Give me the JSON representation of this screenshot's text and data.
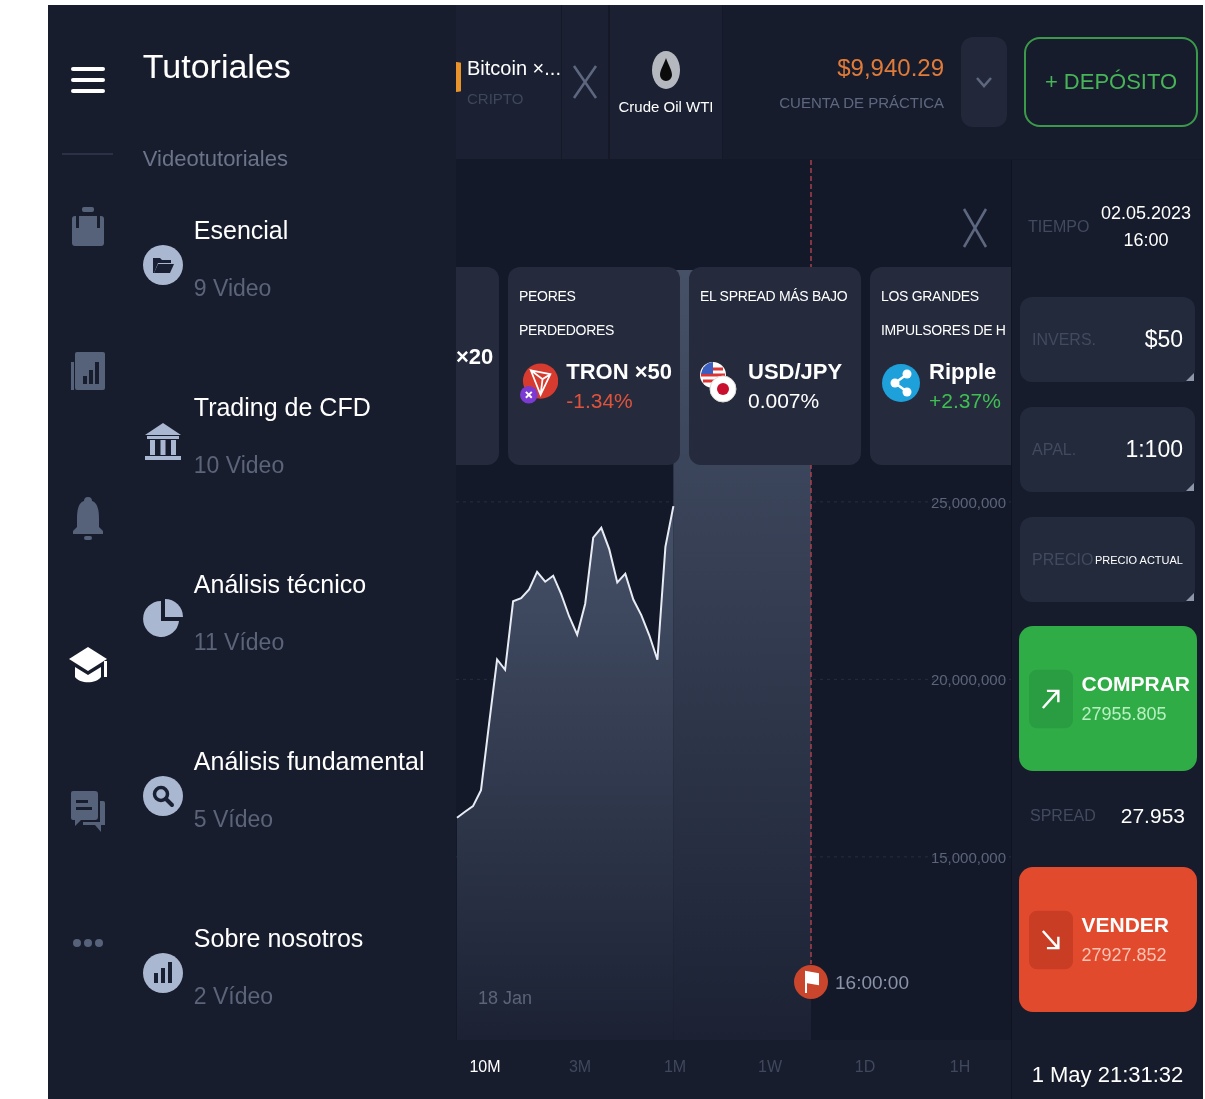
{
  "rail": [
    {
      "kind": "briefcase",
      "selected": false
    },
    {
      "kind": "chart",
      "selected": false
    },
    {
      "kind": "bell",
      "selected": false
    },
    {
      "kind": "cap",
      "selected": true
    },
    {
      "kind": "chat",
      "selected": false
    },
    {
      "kind": "more",
      "selected": false
    }
  ],
  "tutorials": {
    "title": "Tutoriales",
    "section": "Videotutoriales",
    "items": [
      {
        "kind": "folder",
        "title": "Esencial",
        "count": "9 Video"
      },
      {
        "kind": "bank",
        "title": "Trading de CFD",
        "count": "10 Video"
      },
      {
        "kind": "pie",
        "title": "Análisis técnico",
        "count": "11 Vídeo"
      },
      {
        "kind": "search",
        "title": "Análisis fundamental",
        "count": "5 Vídeo"
      },
      {
        "kind": "bars",
        "title": "Sobre nosotros",
        "count": "2 Vídeo"
      }
    ]
  },
  "tabs": [
    {
      "kind": "crypto",
      "title": "Bitcoin ×...",
      "subtitle": "CRIPTO"
    },
    {
      "kind": "oil",
      "title": "Crude Oil WTI"
    }
  ],
  "balance": {
    "amount": "$9,940.29",
    "account": "CUENTA DE PRÁCTICA"
  },
  "deposit_button": "+ DEPÓSITO",
  "cards": [
    {
      "kind": "stub",
      "name": "×20"
    },
    {
      "kind": "tron",
      "title": "PEORES PERDEDORES",
      "name": "TRON ×50",
      "change": "-1.34%",
      "color": "#e0533a"
    },
    {
      "kind": "flags",
      "title": "EL SPREAD MÁS BAJO",
      "name": "USD/JPY",
      "change": "0.007%",
      "color": "#ffffff"
    },
    {
      "kind": "ripple",
      "title": "LOS GRANDES IMPULSORES DE H",
      "name": "Ripple",
      "change": "+2.37%",
      "color": "#3fbf52"
    }
  ],
  "chart": {
    "chart_data": {
      "type": "area",
      "grid": true,
      "ylim": [
        8263604,
        34630000
      ],
      "categories": [
        null,
        null,
        null,
        null,
        null,
        null,
        null,
        null,
        null,
        null,
        null,
        null,
        null,
        null,
        null,
        null,
        null,
        null,
        null,
        null,
        null,
        null,
        null,
        null,
        null,
        null,
        null,
        null,
        null,
        null,
        null,
        null,
        null,
        null,
        null,
        null,
        null,
        null,
        null,
        null,
        null,
        null,
        null,
        null,
        null,
        null,
        null,
        null,
        null,
        null,
        null,
        null,
        null,
        null,
        null,
        null,
        null,
        null,
        null,
        null,
        null,
        null,
        null,
        null,
        null,
        null,
        null,
        null,
        null,
        null
      ],
      "values": [
        16100000,
        16270000,
        16430000,
        16880000,
        18750000,
        20560000,
        20270000,
        22200000,
        22290000,
        22530000,
        23030000,
        22750000,
        22920000,
        22400000,
        21770000,
        21260000,
        22130000,
        23990000,
        24270000,
        23660000,
        22730000,
        22980000,
        22250000,
        21810000,
        21240000,
        20550000,
        23730000,
        24880000,
        null,
        null,
        null,
        null,
        null,
        null,
        null,
        null,
        null,
        null,
        null,
        null,
        null,
        null,
        null,
        null,
        null,
        null,
        null,
        null,
        null,
        null,
        null,
        null,
        null,
        null,
        null,
        null,
        null,
        null,
        null,
        null,
        null,
        null,
        null,
        null,
        null,
        null,
        null,
        null,
        null,
        null
      ],
      "yticks": [
        {
          "value": 15000000,
          "label": "15,000,000"
        },
        {
          "value": 20000000,
          "label": "20,000,000"
        },
        {
          "value": 25000000,
          "label": "25,000,000"
        }
      ],
      "annotations": [
        "18 Jan",
        "16:00:00"
      ]
    }
  },
  "timeframes": [
    {
      "label": "10M",
      "selected": true
    },
    {
      "label": "3M",
      "selected": false
    },
    {
      "label": "1M",
      "selected": false
    },
    {
      "label": "1W",
      "selected": false
    },
    {
      "label": "1D",
      "selected": false
    },
    {
      "label": "1H",
      "selected": false
    }
  ],
  "expiry": {
    "label": "TIEMPO",
    "date": "02.05.2023",
    "time": "16:00"
  },
  "fields": [
    {
      "kind": "number",
      "label": "INVERS.",
      "value": "$50"
    },
    {
      "kind": "number",
      "label": "APAL.",
      "value": "1:100"
    },
    {
      "kind": "option",
      "label": "PRECIO",
      "value": "PRECIO ACTUAL"
    }
  ],
  "buy": {
    "label": "COMPRAR",
    "price": "27955.805"
  },
  "spread": {
    "label": "SPREAD",
    "value": "27.953"
  },
  "sell": {
    "label": "VENDER",
    "price": "27927.852"
  },
  "clock": "1 May 21:31:32"
}
